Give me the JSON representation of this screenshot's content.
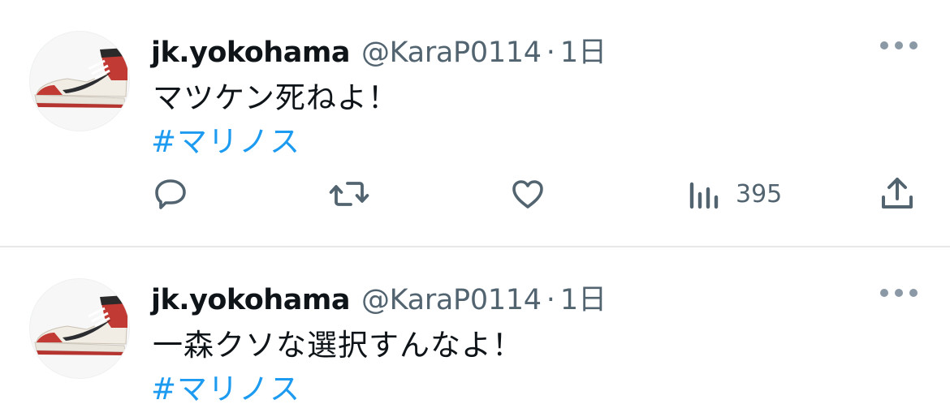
{
  "tweets": [
    {
      "display_name": "jk.yokohama",
      "handle": "@KaraP0114",
      "separator": "·",
      "time": "1日",
      "text": "マツケン死ねよ！",
      "hashtag": "#マリノス",
      "avatar_icon": "sneaker-avatar",
      "more_icon": "more-options-icon",
      "actions": {
        "reply_icon": "reply-icon",
        "retweet_icon": "retweet-icon",
        "like_icon": "like-icon",
        "views_icon": "views-icon",
        "views_count": "395",
        "share_icon": "share-icon"
      }
    },
    {
      "display_name": "jk.yokohama",
      "handle": "@KaraP0114",
      "separator": "·",
      "time": "1日",
      "text": "一森クソな選択すんなよ！",
      "hashtag": "#マリノス",
      "avatar_icon": "sneaker-avatar",
      "more_icon": "more-options-icon"
    }
  ],
  "colors": {
    "text_primary": "#0f1419",
    "text_secondary": "#536471",
    "link": "#1d9bf0",
    "divider": "#e6e8ea"
  }
}
